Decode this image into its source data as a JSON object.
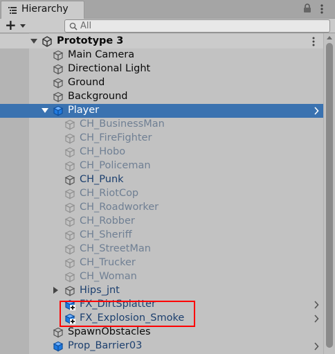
{
  "tab": {
    "title": "Hierarchy",
    "icon": "list-icon"
  },
  "toolbar": {
    "add_icon": "plus-icon",
    "search_placeholder": "All"
  },
  "colors": {
    "selection": "#3a72b0",
    "prefab_text": "#1c3f6e",
    "inactive_text": "#6f7f93",
    "prefab_cube": "#1f7ae0",
    "highlight": "#ff0000"
  },
  "tree": [
    {
      "label": "Prototype 3",
      "kind": "scene",
      "foldout": "down",
      "icon": "unity-logo-icon",
      "menu": true
    },
    {
      "label": "Main Camera",
      "kind": "normal",
      "icon": "gameobject-cube-icon"
    },
    {
      "label": "Directional Light",
      "kind": "normal",
      "icon": "gameobject-cube-icon"
    },
    {
      "label": "Ground",
      "kind": "normal",
      "icon": "gameobject-cube-icon"
    },
    {
      "label": "Background",
      "kind": "normal",
      "icon": "gameobject-cube-icon"
    },
    {
      "label": "Player",
      "kind": "prefab",
      "foldout": "down",
      "icon": "prefab-cube-icon",
      "selected": true,
      "chevron": true
    },
    {
      "label": "CH_BusinessMan",
      "kind": "inactive",
      "icon": "gameobject-cube-icon"
    },
    {
      "label": "CH_FireFighter",
      "kind": "inactive",
      "icon": "gameobject-cube-icon"
    },
    {
      "label": "CH_Hobo",
      "kind": "inactive",
      "icon": "gameobject-cube-icon"
    },
    {
      "label": "CH_Policeman",
      "kind": "inactive",
      "icon": "gameobject-cube-icon"
    },
    {
      "label": "CH_Punk",
      "kind": "prefab",
      "icon": "gameobject-cube-icon"
    },
    {
      "label": "CH_RiotCop",
      "kind": "inactive",
      "icon": "gameobject-cube-icon"
    },
    {
      "label": "CH_Roadworker",
      "kind": "inactive",
      "icon": "gameobject-cube-icon"
    },
    {
      "label": "CH_Robber",
      "kind": "inactive",
      "icon": "gameobject-cube-icon"
    },
    {
      "label": "CH_Sheriff",
      "kind": "inactive",
      "icon": "gameobject-cube-icon"
    },
    {
      "label": "CH_StreetMan",
      "kind": "inactive",
      "icon": "gameobject-cube-icon"
    },
    {
      "label": "CH_Trucker",
      "kind": "inactive",
      "icon": "gameobject-cube-icon"
    },
    {
      "label": "CH_Woman",
      "kind": "inactive",
      "icon": "gameobject-cube-icon"
    },
    {
      "label": "Hips_jnt",
      "kind": "prefab",
      "foldout": "right",
      "icon": "gameobject-cube-icon"
    },
    {
      "label": "FX_DirtSplatter",
      "kind": "prefab",
      "icon": "prefab-added-icon",
      "chevron": true
    },
    {
      "label": "FX_Explosion_Smoke",
      "kind": "prefab",
      "icon": "prefab-added-icon",
      "chevron": true
    },
    {
      "label": "SpawnObstacles",
      "kind": "normal",
      "icon": "gameobject-cube-icon"
    },
    {
      "label": "Prop_Barrier03",
      "kind": "prefab",
      "icon": "prefab-cube-icon",
      "chevron": true
    }
  ]
}
